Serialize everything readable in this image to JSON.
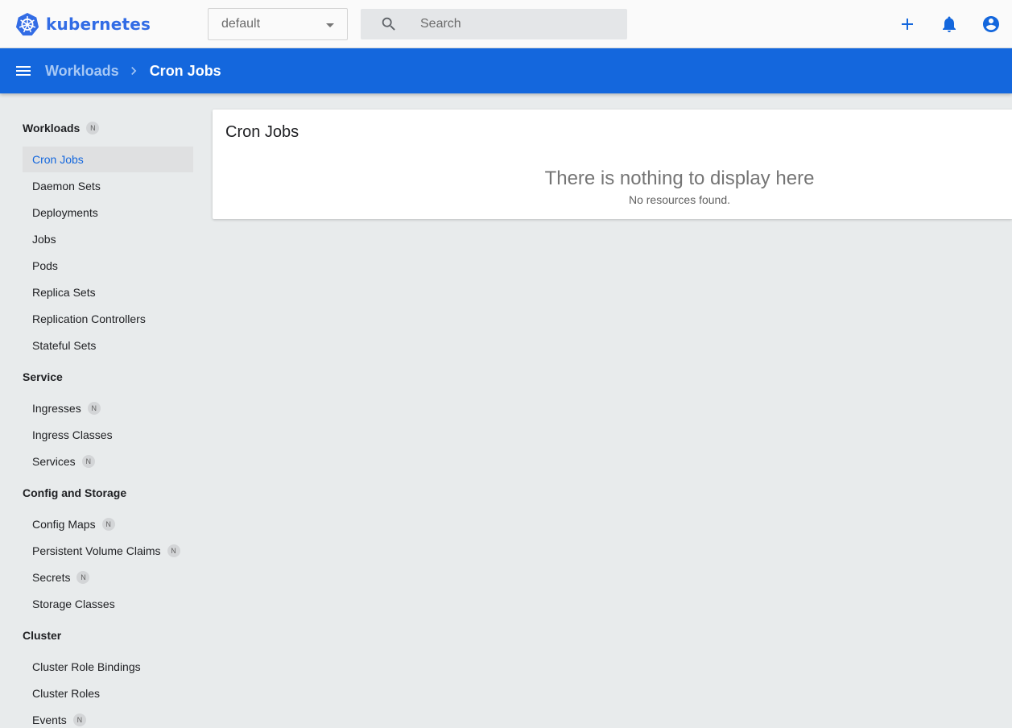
{
  "app": {
    "logo_text": "kubernetes",
    "brand_color": "#326ce5",
    "accent_color": "#1467dd"
  },
  "toolbar": {
    "namespace_selected": "default",
    "search_placeholder": "Search",
    "icons": [
      "add-icon",
      "notifications-icon",
      "account-icon"
    ]
  },
  "breadcrumb": {
    "parent": "Workloads",
    "current": "Cron Jobs"
  },
  "sidebar": {
    "workloads": {
      "label": "Workloads",
      "badge": "N"
    },
    "workload_items": [
      {
        "label": "Cron Jobs",
        "active": true
      },
      {
        "label": "Daemon Sets"
      },
      {
        "label": "Deployments"
      },
      {
        "label": "Jobs"
      },
      {
        "label": "Pods"
      },
      {
        "label": "Replica Sets"
      },
      {
        "label": "Replication Controllers"
      },
      {
        "label": "Stateful Sets"
      }
    ],
    "service": {
      "label": "Service"
    },
    "service_items": [
      {
        "label": "Ingresses",
        "badge": "N"
      },
      {
        "label": "Ingress Classes"
      },
      {
        "label": "Services",
        "badge": "N"
      }
    ],
    "config": {
      "label": "Config and Storage"
    },
    "config_items": [
      {
        "label": "Config Maps",
        "badge": "N"
      },
      {
        "label": "Persistent Volume Claims",
        "badge": "N"
      },
      {
        "label": "Secrets",
        "badge": "N"
      },
      {
        "label": "Storage Classes"
      }
    ],
    "cluster": {
      "label": "Cluster"
    },
    "cluster_items": [
      {
        "label": "Cluster Role Bindings"
      },
      {
        "label": "Cluster Roles"
      },
      {
        "label": "Events",
        "badge": "N"
      }
    ]
  },
  "main": {
    "card_title": "Cron Jobs",
    "empty_title": "There is nothing to display here",
    "empty_subtitle": "No resources found."
  }
}
